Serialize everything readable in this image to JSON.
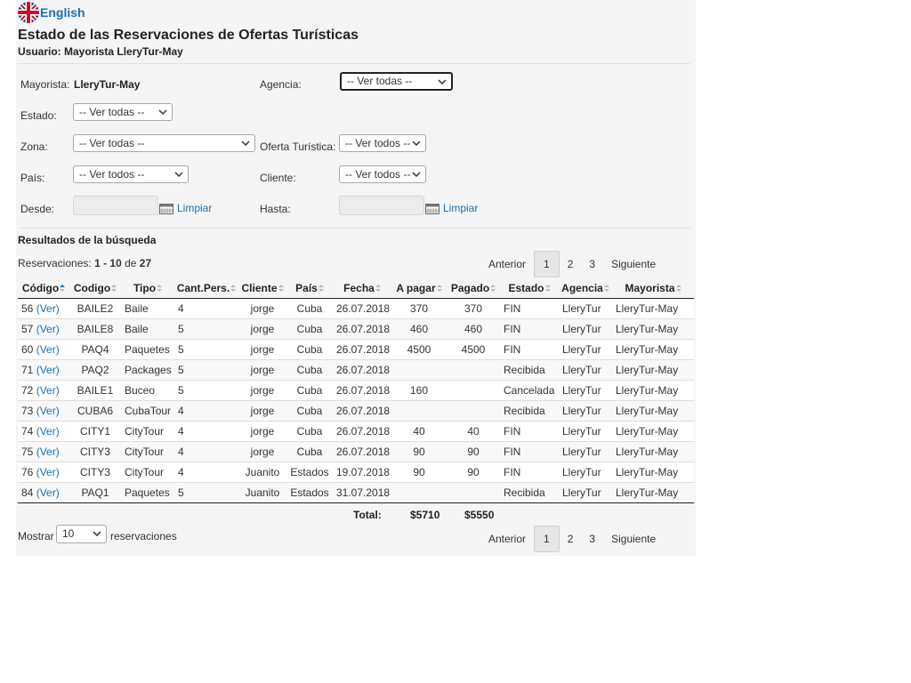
{
  "language": {
    "label": "English"
  },
  "page": {
    "title": "Estado de las Reservaciones de Ofertas Turísticas",
    "user_label": "Usuario: Mayorista LleryTur-May"
  },
  "filters": {
    "mayorista_label": "Mayorista:",
    "mayorista_value": "LleryTur-May",
    "agencia_label": "Agencia:",
    "agencia_value": "-- Ver todas --",
    "estado_label": "Estado:",
    "estado_value": "-- Ver todas --",
    "zona_label": "Zona:",
    "zona_value": "-- Ver todas --",
    "oferta_label": "Oferta Turística:",
    "oferta_value": "-- Ver todos --",
    "pais_label": "País:",
    "pais_value": "-- Ver todos --",
    "cliente_label": "Cliente:",
    "cliente_value": "-- Ver todos --",
    "desde_label": "Desde:",
    "hasta_label": "Hasta:",
    "clear_label": "Limpiar"
  },
  "results": {
    "title": "Resultados de la búsqueda",
    "count_prefix": "Reservaciones:",
    "range": "1 - 10",
    "of": "de",
    "total": "27"
  },
  "pagination": {
    "prev": "Anterior",
    "pages": [
      "1",
      "2",
      "3"
    ],
    "next": "Siguiente",
    "current": "1"
  },
  "table": {
    "columns": [
      "Código",
      "Codigo",
      "Tipo",
      "Cant.Pers.",
      "Cliente",
      "País",
      "Fecha",
      "A pagar",
      "Pagado",
      "Estado",
      "Agencia",
      "Mayorista"
    ],
    "view_label": "(Ver)",
    "rows": [
      [
        "56",
        "BAILE2",
        "Baile",
        "4",
        "jorge",
        "Cuba",
        "26.07.2018",
        "370",
        "370",
        "FIN",
        "LleryTur",
        "LleryTur-May"
      ],
      [
        "57",
        "BAILE8",
        "Baile",
        "5",
        "jorge",
        "Cuba",
        "26.07.2018",
        "460",
        "460",
        "FIN",
        "LleryTur",
        "LleryTur-May"
      ],
      [
        "60",
        "PAQ4",
        "Paquetes",
        "5",
        "jorge",
        "Cuba",
        "26.07.2018",
        "4500",
        "4500",
        "FIN",
        "LleryTur",
        "LleryTur-May"
      ],
      [
        "71",
        "PAQ2",
        "Packages",
        "5",
        "jorge",
        "Cuba",
        "26.07.2018",
        "",
        "",
        "Recibida",
        "LleryTur",
        "LleryTur-May"
      ],
      [
        "72",
        "BAILE1",
        "Buceo",
        "5",
        "jorge",
        "Cuba",
        "26.07.2018",
        "160",
        "",
        "Cancelada",
        "LleryTur",
        "LleryTur-May"
      ],
      [
        "73",
        "CUBA6",
        "CubaTour",
        "4",
        "jorge",
        "Cuba",
        "26.07.2018",
        "",
        "",
        "Recibida",
        "LleryTur",
        "LleryTur-May"
      ],
      [
        "74",
        "CITY1",
        "CityTour",
        "4",
        "jorge",
        "Cuba",
        "26.07.2018",
        "40",
        "40",
        "FIN",
        "LleryTur",
        "LleryTur-May"
      ],
      [
        "75",
        "CITY3",
        "CityTour",
        "4",
        "jorge",
        "Cuba",
        "26.07.2018",
        "90",
        "90",
        "FIN",
        "LleryTur",
        "LleryTur-May"
      ],
      [
        "76",
        "CITY3",
        "CityTour",
        "4",
        "Juanito",
        "Estados",
        "19.07.2018",
        "90",
        "90",
        "FIN",
        "LleryTur",
        "LleryTur-May"
      ],
      [
        "84",
        "PAQ1",
        "Paquetes",
        "5",
        "Juanito",
        "Estados",
        "31.07.2018",
        "",
        "",
        "Recibida",
        "LleryTur",
        "LleryTur-May"
      ]
    ],
    "totals": {
      "label": "Total:",
      "a_pagar": "$5710",
      "pagado": "$5550"
    }
  },
  "show": {
    "prefix": "Mostrar",
    "value": "10",
    "suffix": "reservaciones"
  },
  "colors": {
    "link": "#1a6fb8",
    "panel": "#f5f5f5"
  }
}
